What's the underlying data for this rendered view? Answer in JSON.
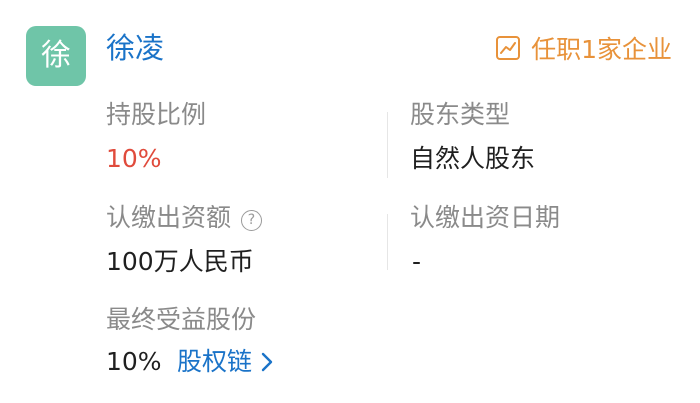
{
  "colors": {
    "avatar_bg": "#6fc5a8",
    "name_link": "#1a73c8",
    "positions_orange": "#e8923a",
    "highlight_red": "#e04b3c",
    "link_blue": "#1a73c8"
  },
  "person": {
    "avatar_char": "徐",
    "name": "徐凌",
    "positions_label": "任职1家企业",
    "positions_icon": "trend-chart-icon"
  },
  "fields": {
    "shareholding_ratio": {
      "label": "持股比例",
      "value": "10%"
    },
    "shareholder_type": {
      "label": "股东类型",
      "value": "自然人股东"
    },
    "subscribed_capital": {
      "label": "认缴出资额",
      "value": "100万人民币",
      "help_icon": "?"
    },
    "subscription_date": {
      "label": "认缴出资日期",
      "value": "-"
    },
    "ultimate_share": {
      "label": "最终受益股份",
      "value": "10%",
      "link_label": "股权链"
    }
  }
}
